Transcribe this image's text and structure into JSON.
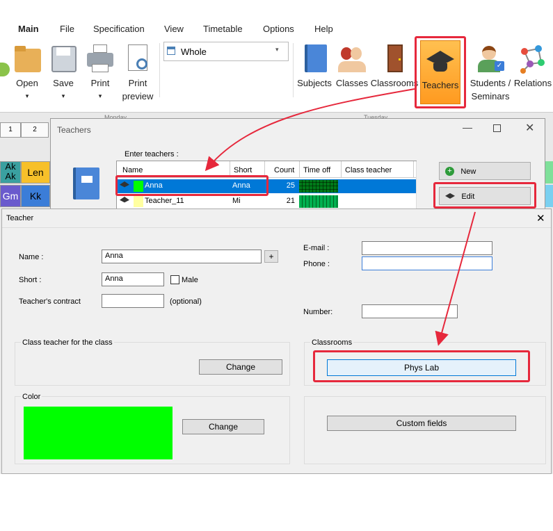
{
  "ribbon": {
    "tabs": [
      "Main",
      "File",
      "Specification",
      "View",
      "Timetable",
      "Options",
      "Help"
    ],
    "buttons": {
      "open": "Open",
      "save": "Save",
      "print": "Print",
      "print_preview": [
        "Print",
        "preview"
      ],
      "view_select": "Whole",
      "subjects": "Subjects",
      "classes": "Classes",
      "classrooms": "Classrooms",
      "teachers": "Teachers",
      "students": [
        "Students /",
        "Seminars"
      ],
      "relations": "Relations"
    }
  },
  "timetable_bg": {
    "days": [
      "Monday",
      "Tuesday"
    ],
    "periods": [
      "1",
      "2"
    ],
    "cells": [
      "Ak",
      "Ak",
      "Len",
      "Gm",
      "Kk"
    ]
  },
  "teachers_window": {
    "title": "Teachers",
    "prompt": "Enter teachers :",
    "columns": [
      "Name",
      "Short",
      "Count",
      "Time off",
      "Class teacher"
    ],
    "rows": [
      {
        "name": "Anna",
        "short": "Anna",
        "count": "25",
        "color": "#00ff00"
      },
      {
        "name": "Teacher_11",
        "short": "Mi",
        "count": "21",
        "color": "#ffffa0"
      }
    ],
    "new_button": "New",
    "edit_button": "Edit"
  },
  "teacher_dialog": {
    "title": "Teacher",
    "name_label": "Name :",
    "name_value": "Anna",
    "plus": "+",
    "short_label": "Short :",
    "short_value": "Anna",
    "male_label": "Male",
    "contract_label": "Teacher's contract",
    "optional": "(optional)",
    "email_label": "E-mail :",
    "phone_label": "Phone :",
    "number_label": "Number:",
    "class_teacher_group": "Class teacher for the class",
    "change": "Change",
    "classrooms_group": "Classrooms",
    "classroom_value": "Phys Lab",
    "color_group": "Color",
    "color_value": "#00ff00",
    "custom_fields": "Custom fields"
  },
  "colors": {
    "highlight": "#e6283c",
    "selection": "#0078d7",
    "teachers_btn": "#ffa020"
  }
}
